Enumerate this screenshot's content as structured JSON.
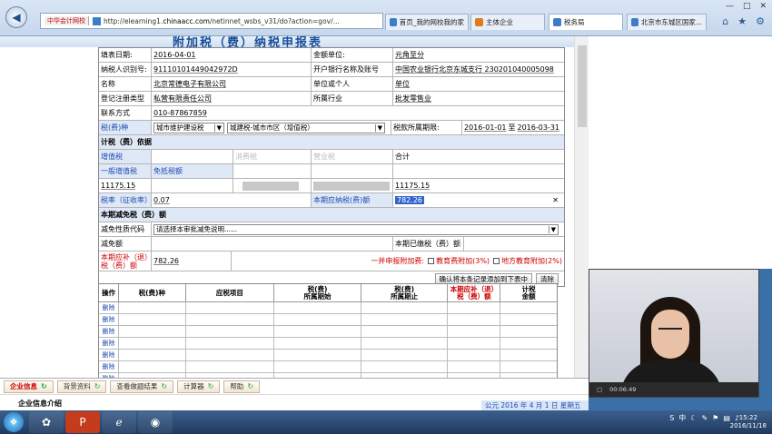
{
  "browser": {
    "site_chip": "中华会计网校",
    "url_prefix": "http://elearning1.",
    "url_domain": "chinaacc.com",
    "url_suffix": "/netinnet_wsbs_v31/do?action=gov/...",
    "tabs": [
      {
        "label": "首页_我的网校我的家"
      },
      {
        "label": "主体企业"
      },
      {
        "label": "税务局"
      },
      {
        "label": "北京市东城区国家..."
      }
    ],
    "window_controls": [
      "—",
      "□",
      "✕"
    ]
  },
  "banner": {
    "title": "附加税（费）纳税申报表"
  },
  "form": {
    "fill_date_label": "填表日期:",
    "fill_date": "2016-04-01",
    "amount_unit_label": "金额单位:",
    "amount_unit": "元角至分",
    "taxpayer_id_label": "纳税人识别号:",
    "taxpayer_id": "91110101449042972D",
    "bank_label": "开户银行名称及账号",
    "bank": "中国农业银行北京东城支行  230201040005098",
    "name_label": "名称",
    "name": "北京常德电子有限公司",
    "unit_or_person_label": "单位或个人",
    "unit_or_person": "单位",
    "reg_type_label": "登记注册类型",
    "reg_type": "私营有限责任公司",
    "industry_label": "所属行业",
    "industry": "批发零售业",
    "contact_label": "联系方式",
    "contact": "010-87867859",
    "tax_type_label": "税(费)种",
    "tax_type_select": "城市维护建设税",
    "tax_item_select": "城建税-城市市区（增值税）",
    "period_label": "税款所属期限:",
    "period_start": "2016-01-01",
    "period_to": "至",
    "period_end": "2016-03-31",
    "calc_section": "计税（费）依据",
    "vat_label": "增值税",
    "consumption_label": "消费税",
    "business_label": "营业税",
    "total_label": "合计",
    "general_vat_label": "一般增值税",
    "exempt_label": "免抵税额",
    "general_vat_value": "11175.15",
    "total_value": "11175.15",
    "rate_label": "税率（征收率）",
    "rate_value": "0.07",
    "payable_label": "本期应纳税(费)额",
    "payable_value": "782.26",
    "clear_icon": "✕",
    "relief_section": "本期减免税（费）额",
    "relief_code_label": "减免性质代码",
    "relief_code_select": "请选择本审批减免说明......",
    "relief_amount_label": "减免额",
    "paid_label": "本期已缴税（费）额",
    "refund_label": "本期应补（退）税（费）额",
    "refund_value": "782.26",
    "surcharge_note": "一并申报附加费:",
    "edu_surcharge": "教育费附加(3%)",
    "local_edu_surcharge": "地方教育附加(2%)",
    "confirm_button": "确认将本条记录添加到下表中",
    "clear_button": "清除"
  },
  "grid": {
    "headers": [
      "操作",
      "税(费)种",
      "应税项目",
      "税(费)\n所属期始",
      "税(费)\n所属期止",
      "本期应补（退）\n税（费）额",
      "计税\n金额"
    ],
    "delete_label": "删除",
    "row_count": 7
  },
  "bottom_tabs": [
    {
      "label": "企业信息"
    },
    {
      "label": "背景资料"
    },
    {
      "label": "查看做题结果"
    },
    {
      "label": "计算器"
    },
    {
      "label": "帮助"
    }
  ],
  "info_bar": {
    "title": "企业信息介绍",
    "date": "公元 2016 年 4 月 1 日 星期五"
  },
  "video": {
    "time": "00:06:49"
  },
  "taskbar": {
    "clock_time": "15:22",
    "clock_date": "2016/11/18",
    "tray_lang": "中"
  }
}
